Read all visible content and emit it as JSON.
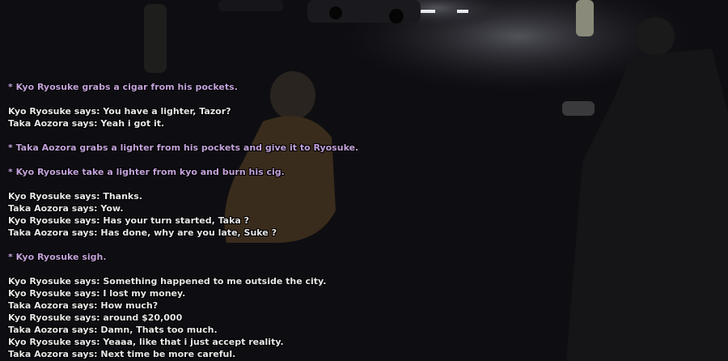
{
  "chat": {
    "lines": [
      {
        "text": "* Kyo Ryosuke grabs a cigar from his pockets.",
        "kind": "action"
      },
      {
        "text": "Kyo Ryosuke says: You have a lighter, Tazor?",
        "kind": "say"
      },
      {
        "text": "Taka Aozora says: Yeah i got it.",
        "kind": "say"
      },
      {
        "text": "* Taka Aozora grabs a lighter from his pockets and give it to Ryosuke.",
        "kind": "action"
      },
      {
        "text": "* Kyo Ryosuke take a lighter from kyo and burn his cig.",
        "kind": "action"
      },
      {
        "text": "Kyo Ryosuke says: Thanks.",
        "kind": "say"
      },
      {
        "text": "Taka Aozora says: Yow.",
        "kind": "say"
      },
      {
        "text": "Kyo Ryosuke says: Has your turn started, Taka ?",
        "kind": "say"
      },
      {
        "text": "Taka Aozora says: Has done, why are you late, Suke ?",
        "kind": "say"
      },
      {
        "text": "* Kyo Ryosuke sigh.",
        "kind": "action"
      },
      {
        "text": "Kyo Ryosuke says: Something happened to me outside the city.",
        "kind": "say"
      },
      {
        "text": "Kyo Ryosuke says: I lost my money.",
        "kind": "say"
      },
      {
        "text": "Taka Aozora says: How much?",
        "kind": "say"
      },
      {
        "text": "Kyo Ryosuke says: around $20,000",
        "kind": "say"
      },
      {
        "text": "Taka Aozora says: Damn, Thats too much.",
        "kind": "say"
      },
      {
        "text": "Kyo Ryosuke says: Yeaaa, like that i just accept reality.",
        "kind": "say"
      },
      {
        "text": "Taka Aozora says: Next time be more careful.",
        "kind": "say"
      }
    ]
  },
  "colors": {
    "say": "#e8e8e8",
    "action": "#c2a2da"
  }
}
